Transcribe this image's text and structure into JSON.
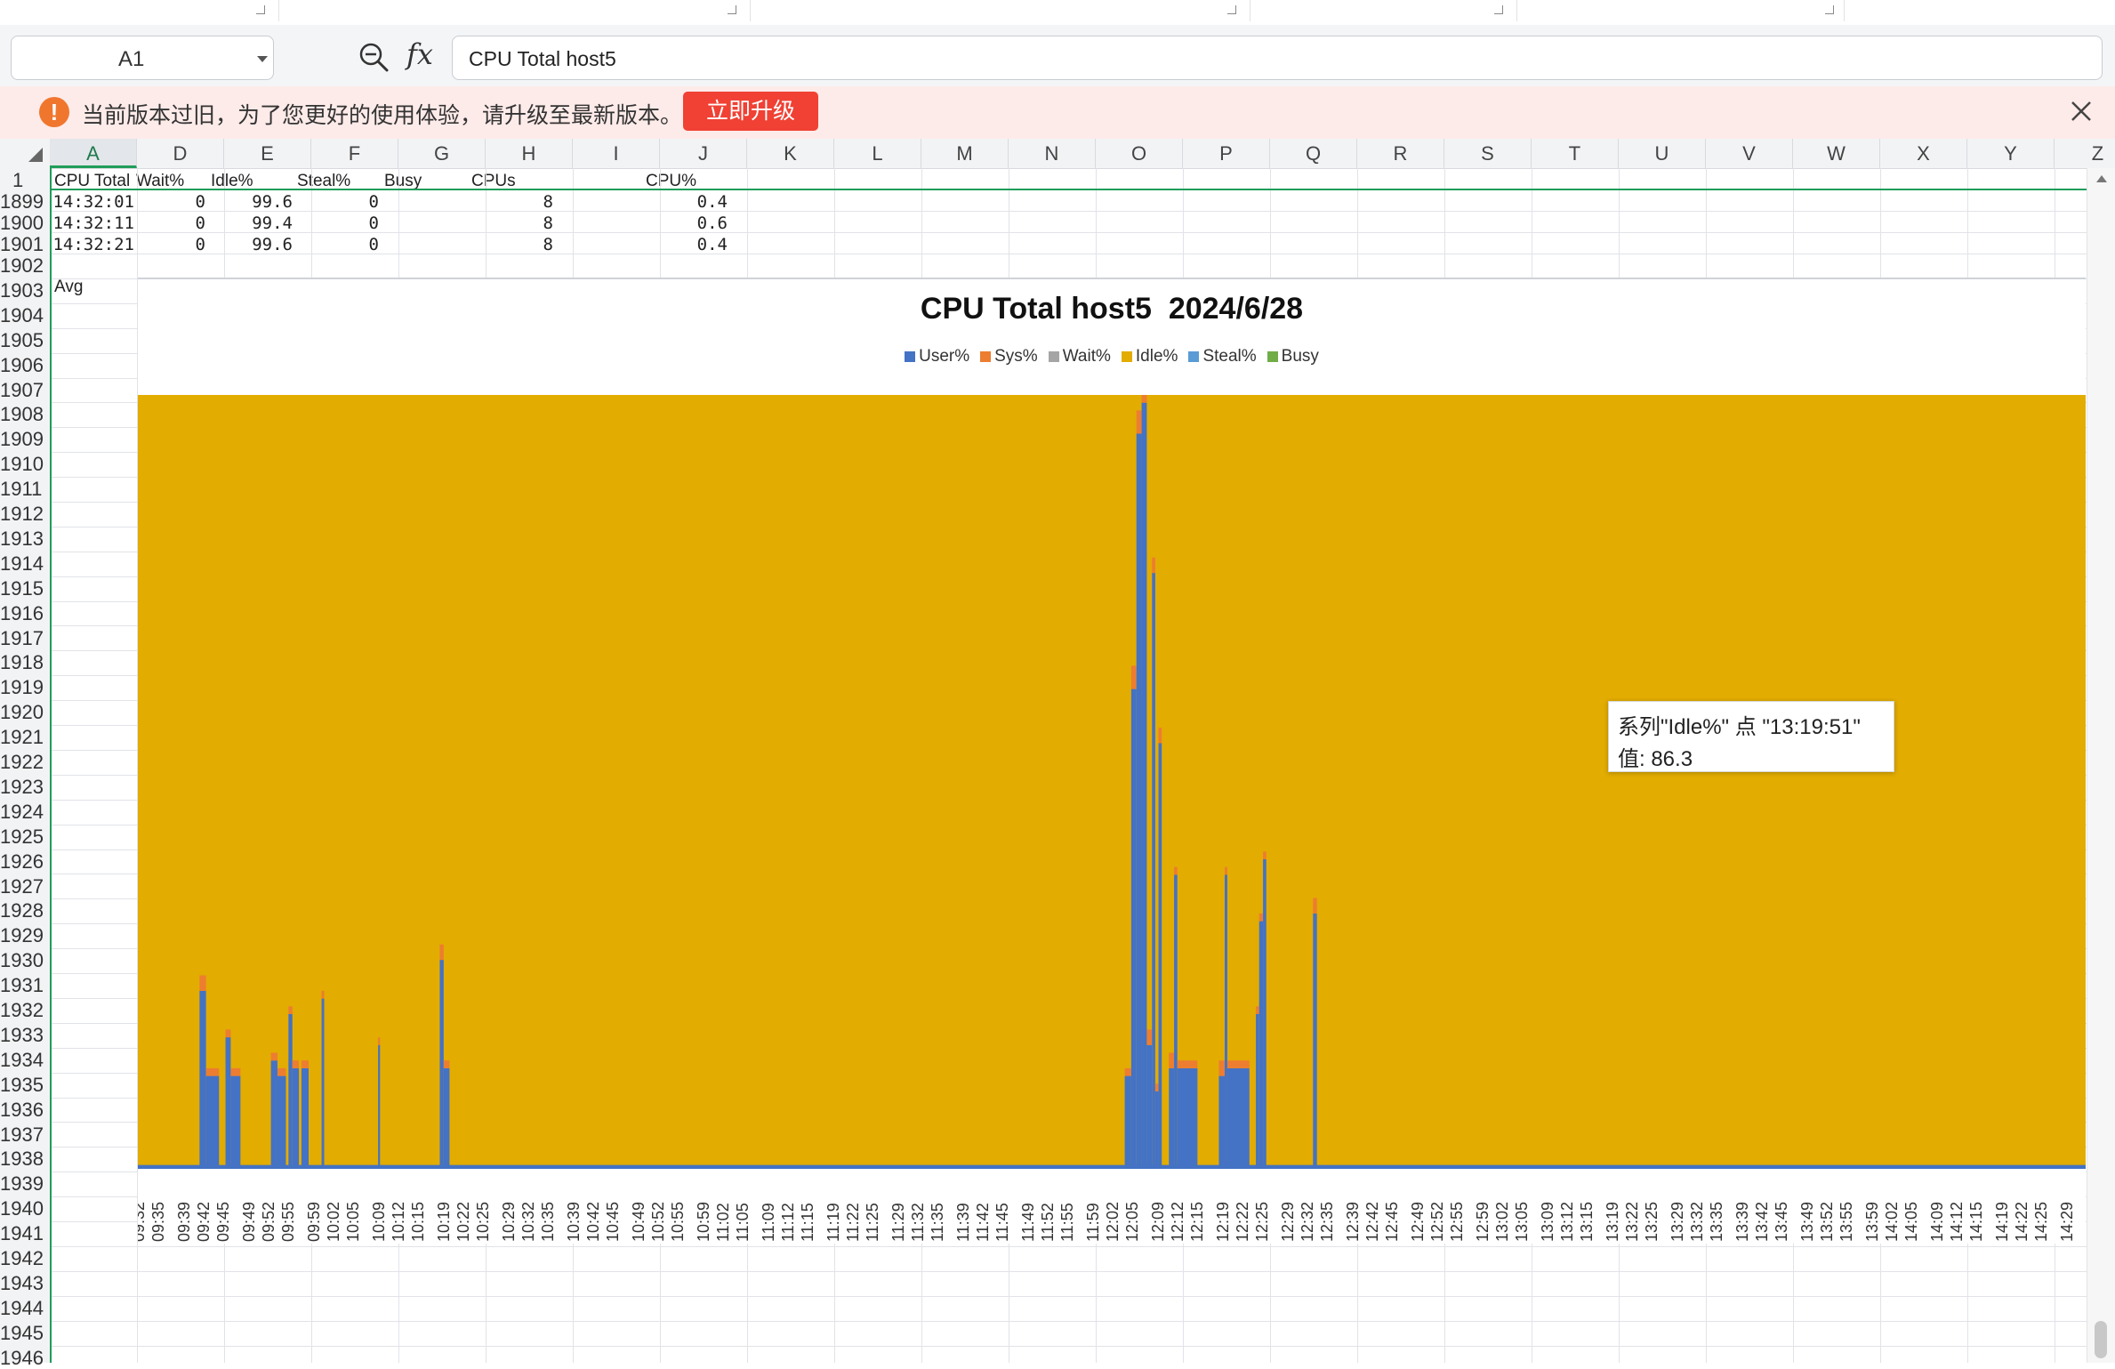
{
  "formula_bar": {
    "name_box": "A1",
    "zoom_icon": "zoom-out-icon",
    "fx_label": "fx",
    "formula": "CPU Total host5"
  },
  "notice": {
    "message": "当前版本过旧，为了您更好的使用体验，请升级至最新版本。",
    "upgrade_button": "立即升级",
    "warning_icon": "exclamation-icon",
    "close_icon": "close-icon"
  },
  "columns": [
    "A",
    "D",
    "E",
    "F",
    "G",
    "H",
    "I",
    "J",
    "K",
    "L",
    "M",
    "N",
    "O",
    "P",
    "Q",
    "R",
    "S",
    "T",
    "U",
    "V",
    "W",
    "X",
    "Y",
    "Z"
  ],
  "rows": [
    "1",
    "1899",
    "1900",
    "1901",
    "1902",
    "1903",
    "1904",
    "1905",
    "1906",
    "1907",
    "1908",
    "1909",
    "1910",
    "1911",
    "1912",
    "1913",
    "1914",
    "1915",
    "1916",
    "1917",
    "1918",
    "1919",
    "1920",
    "1921",
    "1922",
    "1923",
    "1924",
    "1925",
    "1926",
    "1927",
    "1928",
    "1929",
    "1930",
    "1931",
    "1932",
    "1933",
    "1934",
    "1935",
    "1936",
    "1937",
    "1938",
    "1939",
    "1940",
    "1941",
    "1942",
    "1943",
    "1944",
    "1945",
    "1946"
  ],
  "sheet": {
    "header_row": [
      "CPU Total",
      "Wait%",
      "Idle%",
      "Steal%",
      "Busy",
      "CPUs",
      "",
      "CPU%"
    ],
    "data_rows": [
      {
        "time": "14:32:01",
        "wait": "0",
        "idle": "99.6",
        "steal": "0",
        "busy": "",
        "cpus": "8",
        "cpu": "0.4"
      },
      {
        "time": "14:32:11",
        "wait": "0",
        "idle": "99.4",
        "steal": "0",
        "busy": "",
        "cpus": "8",
        "cpu": "0.6"
      },
      {
        "time": "14:32:21",
        "wait": "0",
        "idle": "99.6",
        "steal": "0",
        "busy": "",
        "cpus": "8",
        "cpu": "0.4"
      }
    ],
    "avg_label": "Avg"
  },
  "tooltip": {
    "line1": "系列\"Idle%\" 点 \"13:19:51\"",
    "line2": "值: 86.3"
  },
  "chart_data": {
    "type": "area",
    "stacked": true,
    "title": "CPU Total host5  2024/6/28",
    "xlabel": "",
    "ylabel": "",
    "ylim": [
      0,
      100
    ],
    "grid": false,
    "legend_position": "top",
    "series": [
      {
        "name": "User%",
        "color": "#4472c4"
      },
      {
        "name": "Sys%",
        "color": "#ed7d31"
      },
      {
        "name": "Wait%",
        "color": "#a5a5a5"
      },
      {
        "name": "Idle%",
        "color": "#e2ac00"
      },
      {
        "name": "Steal%",
        "color": "#5b9bd5"
      },
      {
        "name": "Busy",
        "color": "#70ad47"
      }
    ],
    "x_ticks": [
      "09:32",
      "09:35",
      "09:39",
      "09:42",
      "09:45",
      "09:49",
      "09:52",
      "09:55",
      "09:59",
      "10:02",
      "10:05",
      "10:09",
      "10:12",
      "10:15",
      "10:19",
      "10:22",
      "10:25",
      "10:29",
      "10:32",
      "10:35",
      "10:39",
      "10:42",
      "10:45",
      "10:49",
      "10:52",
      "10:55",
      "10:59",
      "11:02",
      "11:05",
      "11:09",
      "11:12",
      "11:15",
      "11:19",
      "11:22",
      "11:25",
      "11:29",
      "11:32",
      "11:35",
      "11:39",
      "11:42",
      "11:45",
      "11:49",
      "11:52",
      "11:55",
      "11:59",
      "12:02",
      "12:05",
      "12:09",
      "12:12",
      "12:15",
      "12:19",
      "12:22",
      "12:25",
      "12:29",
      "12:32",
      "12:35",
      "12:39",
      "12:42",
      "12:45",
      "12:49",
      "12:52",
      "12:55",
      "12:59",
      "13:02",
      "13:05",
      "13:09",
      "13:12",
      "13:15",
      "13:19",
      "13:22",
      "13:25",
      "13:29",
      "13:32",
      "13:35",
      "13:39",
      "13:42",
      "13:45",
      "13:49",
      "13:52",
      "13:55",
      "13:59",
      "14:02",
      "14:05",
      "14:09",
      "14:12",
      "14:15",
      "14:19",
      "14:22",
      "14:25",
      "14:29"
    ],
    "x_range": [
      "09:32",
      "14:32"
    ],
    "busy_segments_minutes": [
      {
        "start": 9.5,
        "end": 10.5,
        "user": 23,
        "sys": 2
      },
      {
        "start": 10.5,
        "end": 12.5,
        "user": 12,
        "sys": 1
      },
      {
        "start": 13.5,
        "end": 14.3,
        "user": 17,
        "sys": 1
      },
      {
        "start": 14.3,
        "end": 15.8,
        "user": 12,
        "sys": 1
      },
      {
        "start": 20.5,
        "end": 21.5,
        "user": 14,
        "sys": 1
      },
      {
        "start": 21.5,
        "end": 22.8,
        "user": 12,
        "sys": 1
      },
      {
        "start": 23.2,
        "end": 23.8,
        "user": 20,
        "sys": 1
      },
      {
        "start": 23.8,
        "end": 24.8,
        "user": 13,
        "sys": 1
      },
      {
        "start": 25.2,
        "end": 26.3,
        "user": 13,
        "sys": 1
      },
      {
        "start": 28.3,
        "end": 28.7,
        "user": 22,
        "sys": 1
      },
      {
        "start": 37.0,
        "end": 37.3,
        "user": 16,
        "sys": 1
      },
      {
        "start": 46.5,
        "end": 47.1,
        "user": 27,
        "sys": 2
      },
      {
        "start": 47.1,
        "end": 48.0,
        "user": 13,
        "sys": 1
      },
      {
        "start": 152.0,
        "end": 153.0,
        "user": 12,
        "sys": 1
      },
      {
        "start": 153.0,
        "end": 153.8,
        "user": 62,
        "sys": 3
      },
      {
        "start": 153.8,
        "end": 154.6,
        "user": 95,
        "sys": 3
      },
      {
        "start": 154.6,
        "end": 155.4,
        "user": 99,
        "sys": 1
      },
      {
        "start": 155.4,
        "end": 156.2,
        "user": 16,
        "sys": 2
      },
      {
        "start": 156.2,
        "end": 156.7,
        "user": 77,
        "sys": 2
      },
      {
        "start": 156.7,
        "end": 157.2,
        "user": 10,
        "sys": 1
      },
      {
        "start": 157.2,
        "end": 157.7,
        "user": 55,
        "sys": 2
      },
      {
        "start": 158.8,
        "end": 159.6,
        "user": 13,
        "sys": 2
      },
      {
        "start": 159.6,
        "end": 160.1,
        "user": 38,
        "sys": 1
      },
      {
        "start": 160.1,
        "end": 163.2,
        "user": 13,
        "sys": 1
      },
      {
        "start": 166.5,
        "end": 167.4,
        "user": 12,
        "sys": 2
      },
      {
        "start": 167.4,
        "end": 167.8,
        "user": 38,
        "sys": 1
      },
      {
        "start": 167.8,
        "end": 171.2,
        "user": 13,
        "sys": 1
      },
      {
        "start": 172.2,
        "end": 172.7,
        "user": 20,
        "sys": 1
      },
      {
        "start": 172.7,
        "end": 173.3,
        "user": 32,
        "sys": 1
      },
      {
        "start": 173.3,
        "end": 173.8,
        "user": 40,
        "sys": 1
      },
      {
        "start": 181.0,
        "end": 181.6,
        "user": 33,
        "sys": 2
      }
    ]
  }
}
